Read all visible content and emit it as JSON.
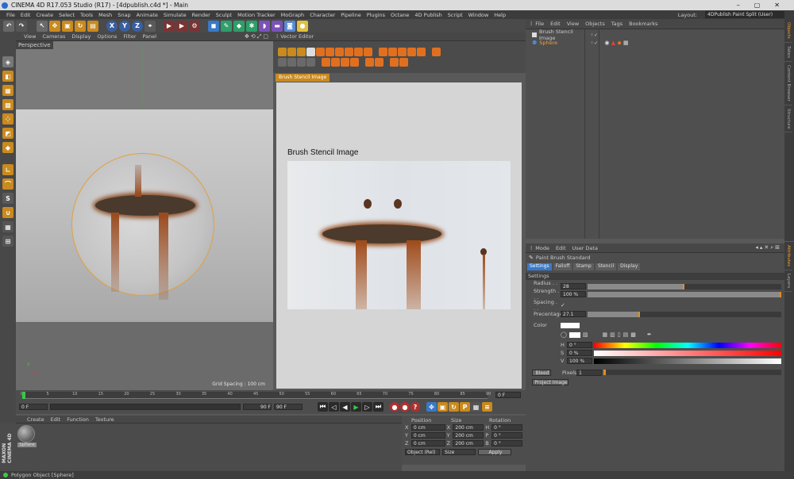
{
  "window": {
    "title": "CINEMA 4D R17.053 Studio (R17) - [4dpublish.c4d *] - Main"
  },
  "main_menu": [
    "File",
    "Edit",
    "Create",
    "Select",
    "Tools",
    "Mesh",
    "Snap",
    "Animate",
    "Simulate",
    "Render",
    "Sculpt",
    "Motion Tracker",
    "MoGraph",
    "Character",
    "Pipeline",
    "Plugins",
    "Octane",
    "4D Publish",
    "Script",
    "Window",
    "Help"
  ],
  "layout": {
    "label": "Layout:",
    "value": "4DPublish Paint Split (User)"
  },
  "viewport": {
    "menu": [
      "View",
      "Cameras",
      "Display",
      "Options",
      "Filter",
      "Panel"
    ],
    "name": "Perspective",
    "grid": "Grid Spacing : 100 cm",
    "axis_y": "Y",
    "axis_x": "X"
  },
  "vector_editor": {
    "title": "Vector Editor",
    "tab": "Brush Stencil Image",
    "image_title": "Brush Stencil Image"
  },
  "object_manager": {
    "menu": [
      "File",
      "Edit",
      "View",
      "Objects",
      "Tags",
      "Bookmarks"
    ],
    "objects": [
      {
        "name": "Brush Stencil Image"
      },
      {
        "name": "Sphere"
      }
    ]
  },
  "side_tabs": [
    "Objects",
    "Takes",
    "Content Browser",
    "Structure"
  ],
  "side_tabs2": [
    "Attributes",
    "Layers"
  ],
  "attributes": {
    "menu": [
      "Mode",
      "Edit",
      "User Data"
    ],
    "title": "Paint Brush Standard",
    "tabs": [
      "Settings",
      "Falloff",
      "Stamp",
      "Stencil",
      "Display"
    ],
    "section": "Settings",
    "radius": {
      "label": "Radius . . . .",
      "value": "28",
      "fill": 0.5
    },
    "strength": {
      "label": "Strength . . .",
      "value": "100 %",
      "fill": 1.0
    },
    "spacing": {
      "label": "Spacing . . .",
      "value": "✓"
    },
    "percentage": {
      "label": "Precentage",
      "value": "27.1",
      "fill": 0.271
    },
    "color_label": "Color",
    "h": {
      "label": "H",
      "value": "0 °"
    },
    "s": {
      "label": "S",
      "value": "0 %"
    },
    "v": {
      "label": "V",
      "value": "100 %"
    },
    "bleed": "Bleed",
    "pixels": {
      "label": "Pixels",
      "value": "1"
    },
    "project_image": "Project Image"
  },
  "timeline": {
    "ticks": [
      "0",
      "5",
      "10",
      "15",
      "20",
      "25",
      "30",
      "35",
      "40",
      "45",
      "50",
      "55",
      "60",
      "65",
      "70",
      "75",
      "80",
      "85",
      "90"
    ],
    "end_label": "0 F",
    "frame_start": "0 F",
    "frame_cur": "0 F",
    "frame_end": "90 F",
    "frame_end2": "90 F"
  },
  "material_manager": {
    "menu": [
      "Create",
      "Edit",
      "Function",
      "Texture"
    ],
    "material": "Sphere",
    "logo": "MAXON CINEMA 4D"
  },
  "coords": {
    "headers": [
      "Position",
      "Size",
      "Rotation"
    ],
    "rows": [
      {
        "a": "X",
        "p": "0 cm",
        "b": "X",
        "s": "200 cm",
        "c": "H",
        "r": "0 °"
      },
      {
        "a": "Y",
        "p": "0 cm",
        "b": "Y",
        "s": "200 cm",
        "c": "P",
        "r": "0 °"
      },
      {
        "a": "Z",
        "p": "0 cm",
        "b": "Z",
        "s": "200 cm",
        "c": "B",
        "r": "0 °"
      }
    ],
    "mode": "Object (Rel)",
    "size_mode": "Size",
    "apply": "Apply"
  },
  "status": {
    "text": "Polygon Object [Sphere]"
  }
}
